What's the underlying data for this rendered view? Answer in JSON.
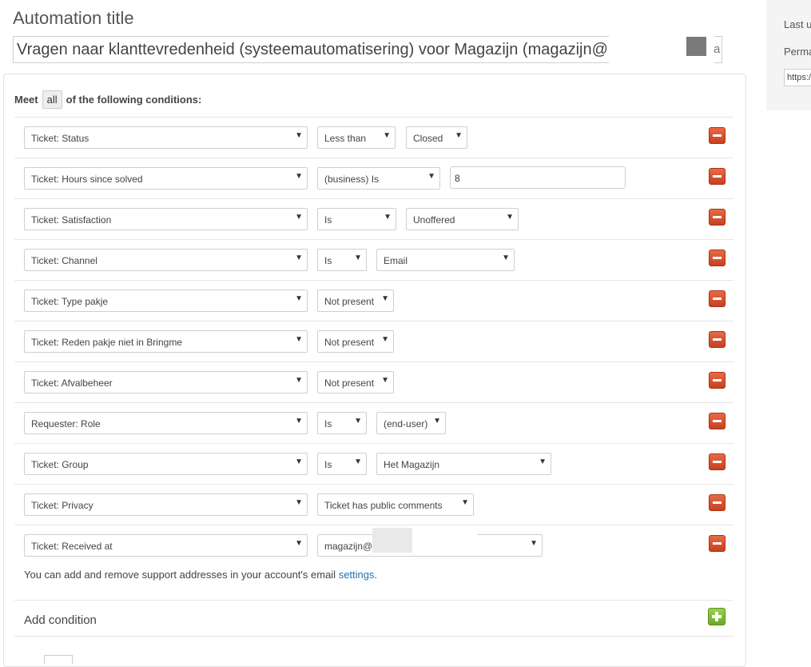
{
  "header": {
    "title": "Automation title",
    "title_value": "Vragen naar klanttevredenheid (systeemautomatisering) voor Magazijn (magazijn@p",
    "title_value_tail": "a"
  },
  "side_panel": {
    "last_updated_label": "Last u",
    "permalink_label": "Perma",
    "permalink_value": "https:/"
  },
  "conditions": {
    "meet_prefix": "Meet",
    "meet_value": "all",
    "meet_suffix": "of the following conditions:",
    "rows": [
      {
        "field": "Ticket: Status",
        "operator": "Less than",
        "value": "Closed",
        "value_kind": "select"
      },
      {
        "field": "Ticket: Hours since solved",
        "operator": "(business) Is",
        "value": "8",
        "value_kind": "text"
      },
      {
        "field": "Ticket: Satisfaction",
        "operator": "Is",
        "value": "Unoffered",
        "value_kind": "select"
      },
      {
        "field": "Ticket: Channel",
        "operator": "Is",
        "value": "Email",
        "value_kind": "select"
      },
      {
        "field": "Ticket: Type pakje",
        "operator": "Not present",
        "value": "",
        "value_kind": "none"
      },
      {
        "field": "Ticket: Reden pakje niet in Bringme",
        "operator": "Not present",
        "value": "",
        "value_kind": "none"
      },
      {
        "field": "Ticket: Afvalbeheer",
        "operator": "Not present",
        "value": "",
        "value_kind": "none"
      },
      {
        "field": "Requester: Role",
        "operator": "Is",
        "value": "(end-user)",
        "value_kind": "select"
      },
      {
        "field": "Ticket: Group",
        "operator": "Is",
        "value": "Het Magazijn",
        "value_kind": "select"
      },
      {
        "field": "Ticket: Privacy",
        "operator": "Ticket has public comments",
        "value": "",
        "value_kind": "none"
      },
      {
        "field": "Ticket: Received at",
        "operator": "magazijn@",
        "value": "",
        "value_kind": "none"
      }
    ],
    "support_note": "You can add and remove support addresses in your account's email",
    "support_link": "settings",
    "support_note_end": ".",
    "add_condition_label": "Add condition"
  },
  "icons": {
    "dropdown": "chevron-down-icon",
    "remove": "minus-icon",
    "add": "plus-icon"
  },
  "colors": {
    "remove_button": "#d9532b",
    "add_button": "#84bd3a",
    "link": "#1f73b7"
  }
}
